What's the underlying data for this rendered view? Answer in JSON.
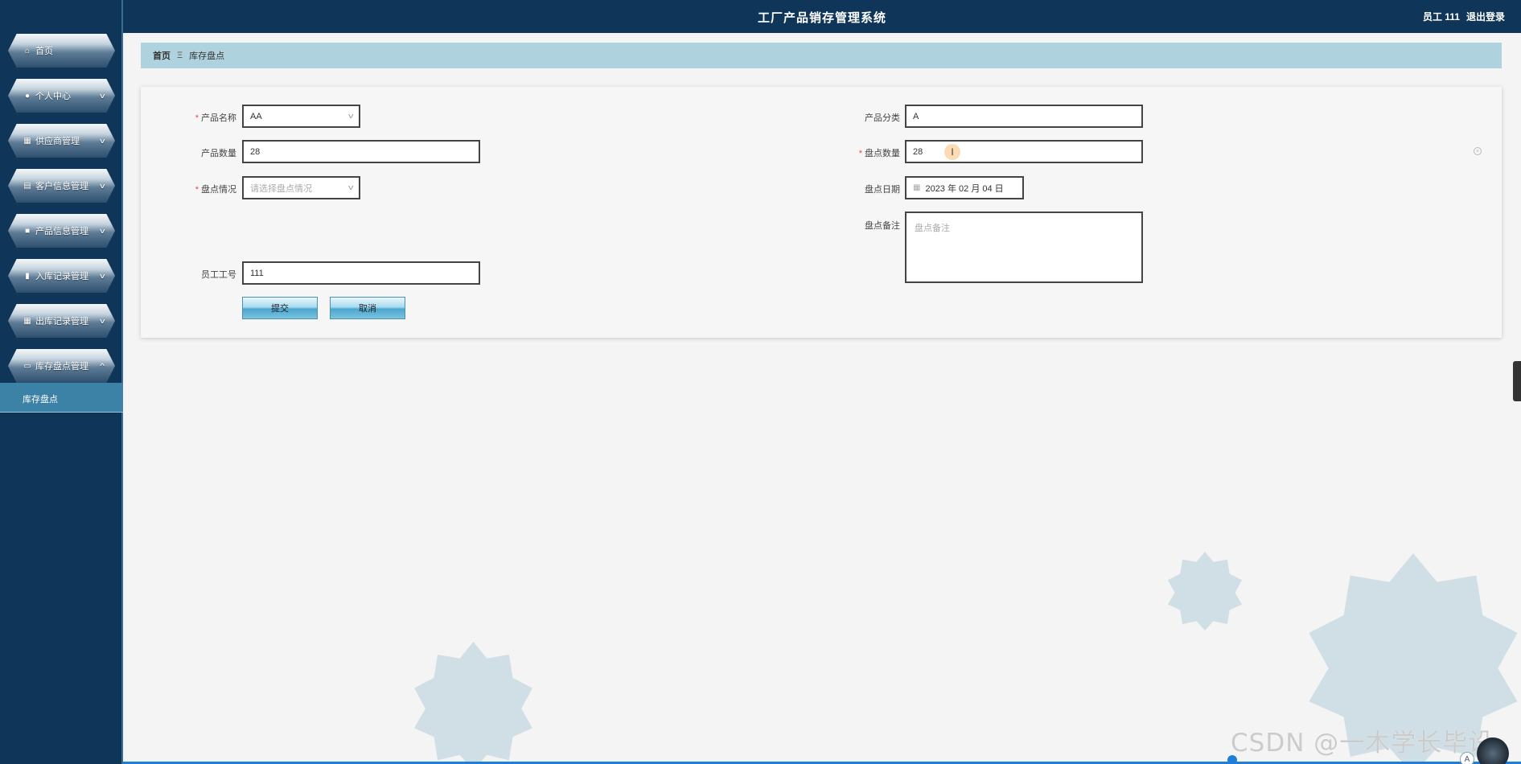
{
  "header": {
    "title": "工厂产品销存管理系统",
    "user_label": "员工 111",
    "logout_label": "退出登录"
  },
  "sidebar": {
    "items": [
      {
        "label": "首页",
        "icon": "home-icon",
        "has_children": false
      },
      {
        "label": "个人中心",
        "icon": "user-icon",
        "has_children": true
      },
      {
        "label": "供应商管理",
        "icon": "grid-icon",
        "has_children": true
      },
      {
        "label": "客户信息管理",
        "icon": "id-card-icon",
        "has_children": true
      },
      {
        "label": "产品信息管理",
        "icon": "briefcase-icon",
        "has_children": true
      },
      {
        "label": "入库记录管理",
        "icon": "clipboard-icon",
        "has_children": true
      },
      {
        "label": "出库记录管理",
        "icon": "grid-icon",
        "has_children": true
      },
      {
        "label": "库存盘点管理",
        "icon": "monitor-icon",
        "has_children": true
      }
    ],
    "submenu_active": "库存盘点"
  },
  "breadcrumb": {
    "home": "首页",
    "separator": "Ξ",
    "current": "库存盘点"
  },
  "form": {
    "product_name": {
      "label": "产品名称",
      "value": "AA",
      "required": true
    },
    "product_category": {
      "label": "产品分类",
      "value": "A",
      "required": false
    },
    "product_quantity": {
      "label": "产品数量",
      "value": "28",
      "required": false
    },
    "count_quantity": {
      "label": "盘点数量",
      "value": "28",
      "required": true
    },
    "count_status": {
      "label": "盘点情况",
      "placeholder": "请选择盘点情况",
      "required": true
    },
    "count_date": {
      "label": "盘点日期",
      "value": "2023 年 02 月 04 日"
    },
    "count_remark": {
      "label": "盘点备注",
      "placeholder": "盘点备注"
    },
    "employee_id": {
      "label": "员工工号",
      "value": "111"
    },
    "submit_label": "提交",
    "cancel_label": "取消"
  },
  "watermark": "CSDN @一木学长毕设",
  "colors": {
    "header_bg": "#0f3559",
    "breadcrumb_bg": "#aed3df",
    "required": "#e5484d",
    "accent": "#1f7fd6"
  }
}
